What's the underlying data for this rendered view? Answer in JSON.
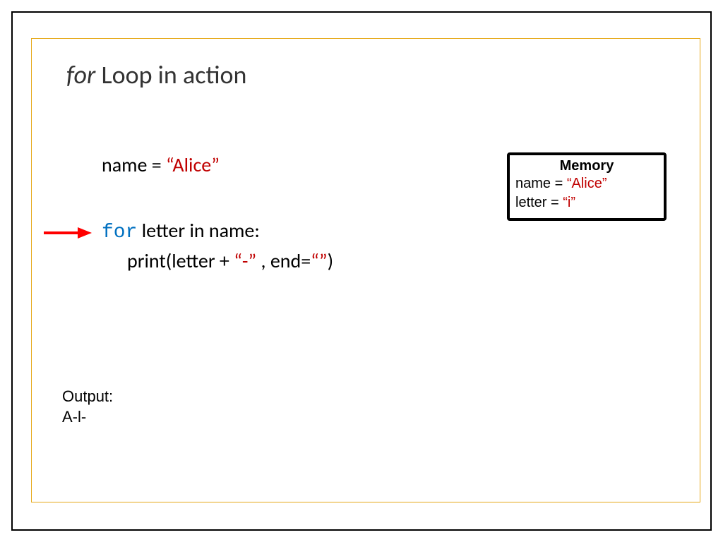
{
  "title": {
    "prefix": "for",
    "rest": " Loop in action"
  },
  "code": {
    "line1_a": "name = ",
    "line1_b": "“Alice”",
    "line2_a": "for",
    "line2_b": " letter in name:",
    "line3_a": "print(letter + ",
    "line3_b": "“-”",
    "line3_c": " , end=",
    "line3_d": "“”",
    "line3_e": ")"
  },
  "memory": {
    "title": "Memory",
    "line1_a": "name = ",
    "line1_b": "“Alice”",
    "line2_a": "letter = ",
    "line2_b": "“i”"
  },
  "output": {
    "label": "Output:",
    "value": "A-l-"
  }
}
